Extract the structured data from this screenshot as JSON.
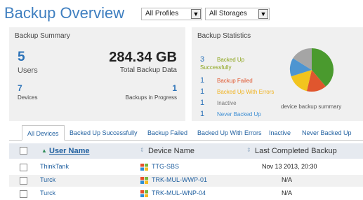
{
  "header": {
    "title": "Backup Overview",
    "profiles_select": "All Profiles",
    "storages_select": "All Storages"
  },
  "summary": {
    "title": "Backup Summary",
    "users_count": "5",
    "users_label": "Users",
    "total_data": "284.34 GB",
    "total_data_label": "Total Backup Data",
    "devices_count": "7",
    "devices_label": "Devices",
    "in_progress_count": "1",
    "in_progress_label": "Backups in Progress"
  },
  "stats": {
    "title": "Backup Statistics",
    "items": [
      {
        "count": "3",
        "label": "Backed Up",
        "label2": "Successfully",
        "color": "#8aa317"
      },
      {
        "count": "1",
        "label": "Backup Failed",
        "color": "#e0562e"
      },
      {
        "count": "1",
        "label": "Backed Up With Errors",
        "color": "#f0b21e"
      },
      {
        "count": "1",
        "label": "Inactive",
        "color": "#888888"
      },
      {
        "count": "1",
        "label": "Never Backed Up",
        "color": "#3f8fd4"
      }
    ],
    "caption": "device backup summary",
    "pie_colors": [
      "#4a9a2e",
      "#e0562e",
      "#f2c41e",
      "#4d95d1",
      "#a5a5a5"
    ]
  },
  "tabs": [
    "All Devices",
    "Backed Up Successfully",
    "Backup Failed",
    "Backed Up With Errors",
    "Inactive",
    "Never Backed Up"
  ],
  "table": {
    "columns": {
      "user": "User Name",
      "device": "Device Name",
      "last": "Last Completed Backup"
    },
    "rows": [
      {
        "user": "ThinkTank",
        "device": "TTG-SBS",
        "last": "Nov 13 2013, 20:30"
      },
      {
        "user": "Turck",
        "device": "TRK-MUL-WWP-01",
        "last": "N/A"
      },
      {
        "user": "Turck",
        "device": "TRK-MUL-WNP-04",
        "last": "N/A"
      }
    ]
  }
}
